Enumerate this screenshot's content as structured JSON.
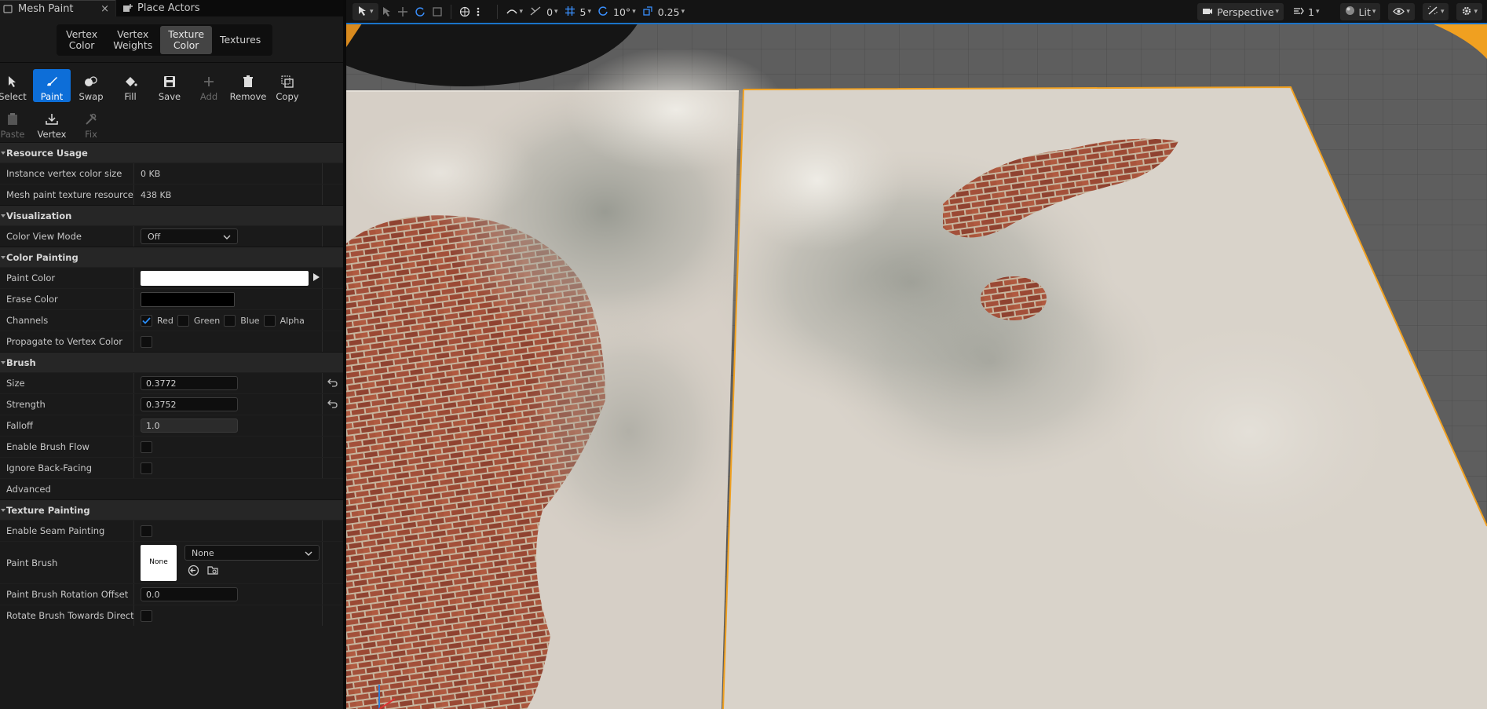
{
  "tabs": {
    "mesh_paint": "Mesh Paint",
    "place_actors": "Place Actors",
    "close_glyph": "×"
  },
  "modes": [
    {
      "label": "Vertex\nColor"
    },
    {
      "label": "Vertex\nWeights"
    },
    {
      "label": "Texture\nColor"
    },
    {
      "label": "Textures"
    }
  ],
  "tools": {
    "select": "Select",
    "paint": "Paint",
    "swap": "Swap",
    "fill": "Fill",
    "save": "Save",
    "add": "Add",
    "remove": "Remove",
    "copy": "Copy",
    "paste": "Paste",
    "vertex": "Vertex",
    "fix": "Fix"
  },
  "sections": {
    "resource_usage": "Resource Usage",
    "visualization": "Visualization",
    "color_painting": "Color Painting",
    "brush": "Brush",
    "texture_painting": "Texture Painting"
  },
  "props": {
    "instance_vertex_color_size": {
      "label": "Instance vertex color size",
      "value": "0 KB"
    },
    "mesh_paint_texture_resource": {
      "label": "Mesh paint texture resource si:",
      "value": "438 KB"
    },
    "color_view_mode": {
      "label": "Color View Mode",
      "value": "Off"
    },
    "paint_color": {
      "label": "Paint Color",
      "color": "#ffffff"
    },
    "erase_color": {
      "label": "Erase Color",
      "color": "#000000"
    },
    "channels": {
      "label": "Channels",
      "red": "Red",
      "green": "Green",
      "blue": "Blue",
      "alpha": "Alpha",
      "red_checked": true
    },
    "propagate": {
      "label": "Propagate to Vertex Color"
    },
    "size": {
      "label": "Size",
      "value": "0.3772"
    },
    "strength": {
      "label": "Strength",
      "value": "0.3752"
    },
    "falloff": {
      "label": "Falloff",
      "value": "1.0"
    },
    "enable_brush_flow": {
      "label": "Enable Brush Flow"
    },
    "ignore_back_facing": {
      "label": "Ignore Back-Facing"
    },
    "advanced": {
      "label": "Advanced"
    },
    "enable_seam_painting": {
      "label": "Enable Seam Painting"
    },
    "paint_brush": {
      "label": "Paint Brush",
      "thumb": "None",
      "value": "None"
    },
    "rotation_offset": {
      "label": "Paint Brush Rotation Offset",
      "value": "0.0"
    },
    "rotate_towards": {
      "label": "Rotate Brush Towards Directi..."
    }
  },
  "viewport": {
    "rotation_snap_count": "0",
    "grid_snap": "5",
    "angle_snap": "10°",
    "scale_snap": "0.25",
    "perspective": "Perspective",
    "camera_speed": "1",
    "view_mode": "Lit",
    "accent": "#1a73c9",
    "selection_outline": "#f0a020"
  },
  "colors": {
    "active_blue": "#0d6ed8",
    "panel_bg": "#1a1a1a",
    "brick": "#a8533a",
    "plaster": "#d9d2c9"
  }
}
